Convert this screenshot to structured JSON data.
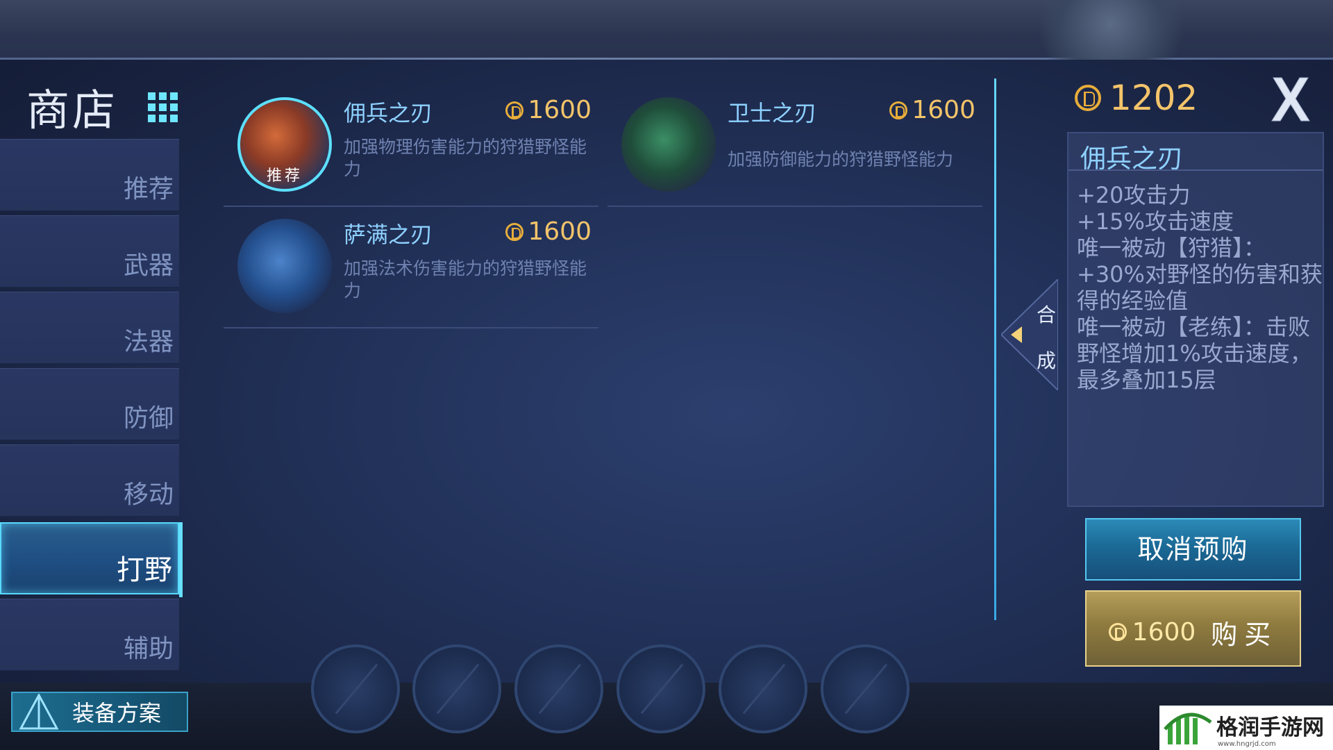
{
  "shop": {
    "title": "商店",
    "categories": [
      {
        "label": "推荐",
        "active": false
      },
      {
        "label": "武器",
        "active": false
      },
      {
        "label": "法器",
        "active": false
      },
      {
        "label": "防御",
        "active": false
      },
      {
        "label": "移动",
        "active": false
      },
      {
        "label": "打野",
        "active": true
      },
      {
        "label": "辅助",
        "active": false
      }
    ],
    "equip_plan_label": "装备方案"
  },
  "items": [
    {
      "name": "佣兵之刃",
      "price": "1600",
      "desc": "加强物理伤害能力的狩猎野怪能力",
      "badge": "推荐",
      "color": "#b34a2a"
    },
    {
      "name": "卫士之刃",
      "price": "1600",
      "desc": "加强防御能力的狩猎野怪能力",
      "color": "#2c6b4a"
    },
    {
      "name": "萨满之刃",
      "price": "1600",
      "desc": "加强法术伤害能力的狩猎野怪能力",
      "color": "#2b5a9e"
    }
  ],
  "combine": {
    "line1": "合",
    "line2": "成"
  },
  "detail_panel": {
    "gold": "1202",
    "title": "佣兵之刃",
    "lines": [
      "+20攻击力",
      "+15%攻击速度",
      "唯一被动【狩猎】：+30%对野怪的伤害和获得的经验值",
      "唯一被动【老练】：击败野怪增加1%攻击速度，最多叠加15层"
    ],
    "cancel_label": "取消预购",
    "buy_price": "1600",
    "buy_label": "购买"
  },
  "watermark": {
    "text": "格润手游网",
    "url": "www.hngrjd.com"
  },
  "colors": {
    "accent": "#59d9ff",
    "gold": "#f3c46a",
    "item_name": "#8ed1ff"
  }
}
